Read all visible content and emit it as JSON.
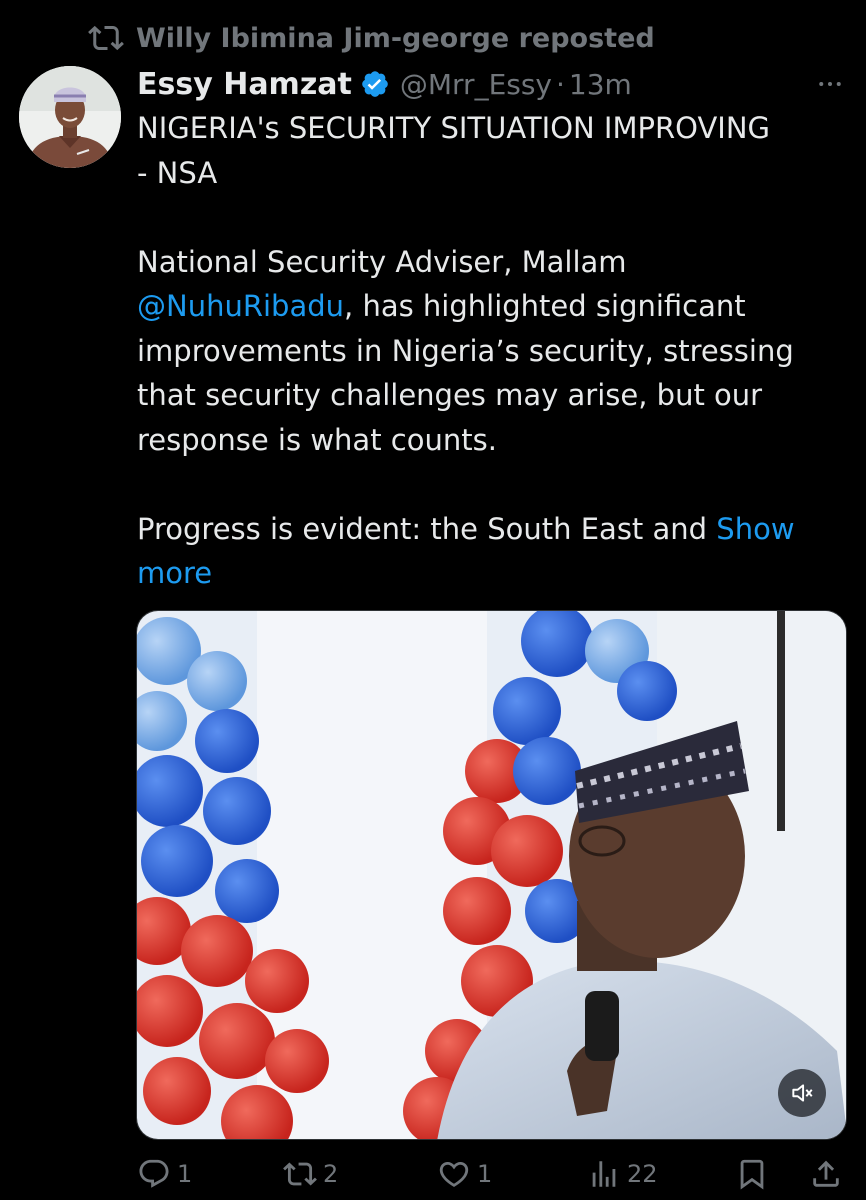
{
  "repost": {
    "label": "Willy Ibimina Jim-george reposted",
    "icon": "repost-icon"
  },
  "author": {
    "display_name": "Essy Hamzat",
    "handle": "@Mrr_Essy",
    "separator": "·",
    "time": "13m",
    "verified": true
  },
  "tweet": {
    "headline_line1": "NIGERIA's SECURITY SITUATION IMPROVING",
    "headline_line2": "- NSA",
    "para1_before_mention": "National Security Adviser, Mallam",
    "mention": "@NuhuRibadu",
    "para1_after_mention": ", has highlighted significant improvements in Nigeria’s security, stressing that security challenges may arise, but our response is what counts.",
    "para2": "Progress is evident: the South East and ",
    "show_more": "Show more"
  },
  "media": {
    "type": "video",
    "mute_icon": "speaker-muted-icon"
  },
  "actions": {
    "replies": "1",
    "reposts": "2",
    "likes": "1",
    "views": "22"
  },
  "colors": {
    "background": "#000000",
    "text": "#e7e9ea",
    "muted": "#71767b",
    "accent": "#1d9bf0"
  }
}
